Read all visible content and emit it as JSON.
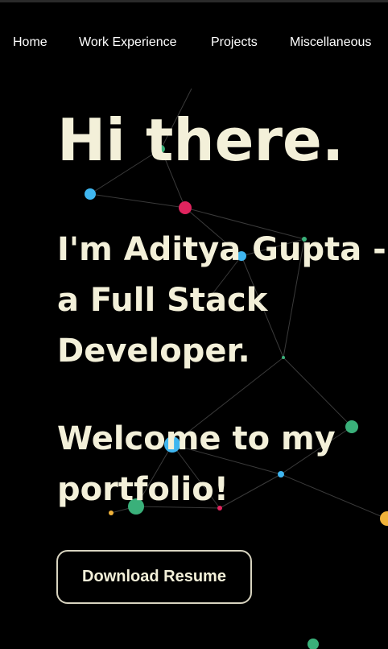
{
  "nav": {
    "items": [
      {
        "label": "Home"
      },
      {
        "label": "Work Experience"
      },
      {
        "label": "Projects"
      },
      {
        "label": "Miscellaneous"
      }
    ]
  },
  "hero": {
    "title": "Hi there.",
    "intro_line1": "I'm Aditya Gupta -",
    "intro_line2": "a Full Stack",
    "intro_line3": "Developer.",
    "welcome_line1": "Welcome to my",
    "welcome_line2": "portfolio!"
  },
  "download_button": {
    "label": "Download Resume"
  },
  "colors": {
    "background": "#000000",
    "text": "#f3f0d9",
    "particle_blue": "#3fb6f0",
    "particle_green": "#3ab07a",
    "particle_pink": "#e0245e",
    "particle_orange": "#f0b23a",
    "link_line": "#3a3a3a"
  }
}
